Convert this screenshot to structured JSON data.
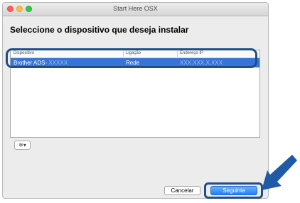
{
  "window": {
    "title": "Start Here OSX"
  },
  "heading": "Seleccione o dispositivo que deseja instalar",
  "table": {
    "columns": [
      "Dispositivo",
      "Ligação",
      "Endereço IP"
    ],
    "rows": [
      {
        "device": "Brother ADS-",
        "device_model": "XXXXX",
        "connection": "Rede",
        "ip": "XXX.XXX.X.XXX"
      }
    ]
  },
  "action_menu": {
    "label": "✲▾"
  },
  "buttons": {
    "cancel": "Cancelar",
    "next": "Seguinte"
  },
  "colors": {
    "selection": "#3874d8",
    "callout": "#1f4f87",
    "primary_button": "#1a82fb"
  },
  "icons": [
    "gear-icon",
    "pointer-arrow-icon"
  ]
}
